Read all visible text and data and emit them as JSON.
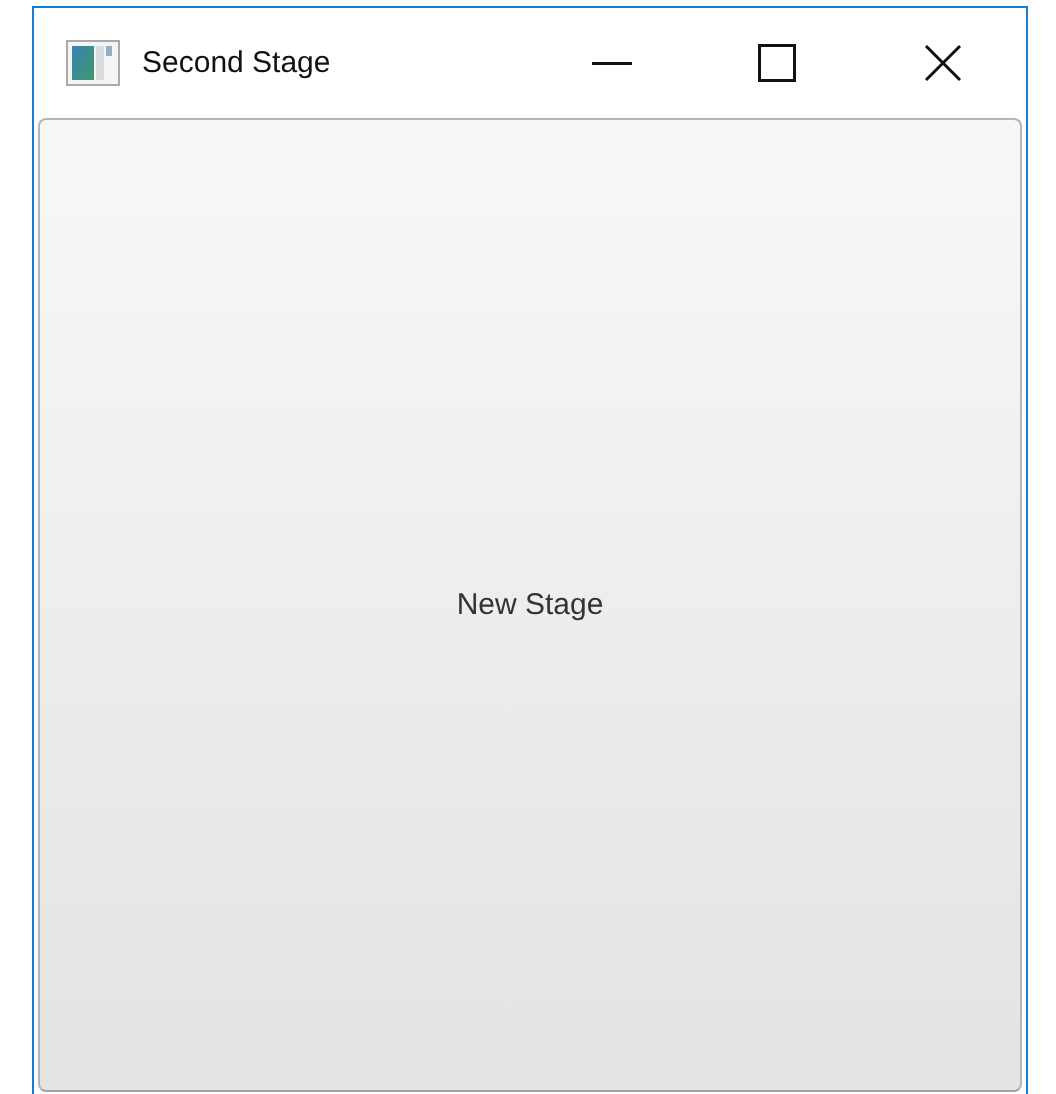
{
  "window": {
    "title": "Second Stage"
  },
  "button": {
    "label": "New Stage"
  }
}
